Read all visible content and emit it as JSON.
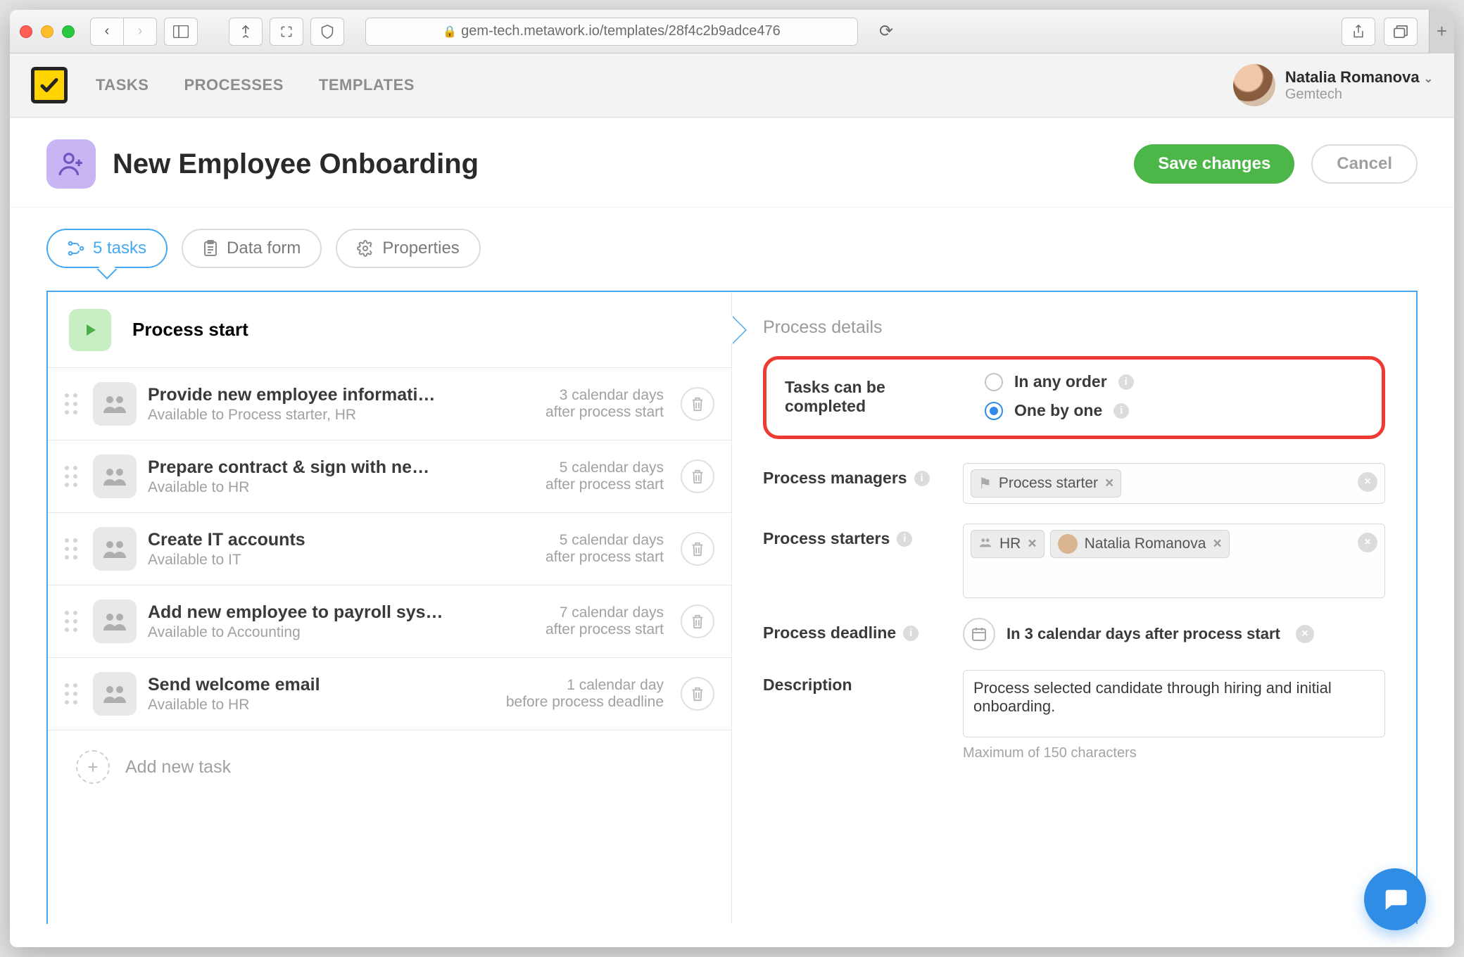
{
  "browser": {
    "url": "gem-tech.metawork.io/templates/28f4c2b9adce476"
  },
  "nav": {
    "tasks": "TASKS",
    "processes": "PROCESSES",
    "templates": "TEMPLATES"
  },
  "user": {
    "name": "Natalia Romanova",
    "org": "Gemtech"
  },
  "title": "New Employee Onboarding",
  "actions": {
    "save": "Save changes",
    "cancel": "Cancel"
  },
  "tabs": {
    "tasks": "5 tasks",
    "dataform": "Data form",
    "properties": "Properties"
  },
  "left": {
    "process_start": "Process start",
    "tasks": [
      {
        "title": "Provide new employee informati…",
        "sub": "Available to Process starter, HR",
        "due1": "3 calendar days",
        "due2": "after process start"
      },
      {
        "title": "Prepare contract & sign with ne…",
        "sub": "Available to HR",
        "due1": "5 calendar days",
        "due2": "after process start"
      },
      {
        "title": "Create IT accounts",
        "sub": "Available to IT",
        "due1": "5 calendar days",
        "due2": "after process start"
      },
      {
        "title": "Add new employee to payroll sys…",
        "sub": "Available to Accounting",
        "due1": "7 calendar days",
        "due2": "after process start"
      },
      {
        "title": "Send welcome email",
        "sub": "Available to HR",
        "due1": "1 calendar day",
        "due2": "before process deadline"
      }
    ],
    "add_new": "Add new task"
  },
  "right": {
    "header": "Process details",
    "completion_label": "Tasks can be completed",
    "opt_any": "In any order",
    "opt_one": "One by one",
    "managers_label": "Process managers",
    "manager_chip": "Process starter",
    "starters_label": "Process starters",
    "starter_hr": "HR",
    "starter_name": "Natalia Romanova",
    "deadline_label": "Process deadline",
    "deadline_value": "In 3 calendar days after process start",
    "desc_label": "Description",
    "desc_value": "Process selected candidate through hiring and initial onboarding.",
    "desc_help": "Maximum of 150 characters"
  }
}
